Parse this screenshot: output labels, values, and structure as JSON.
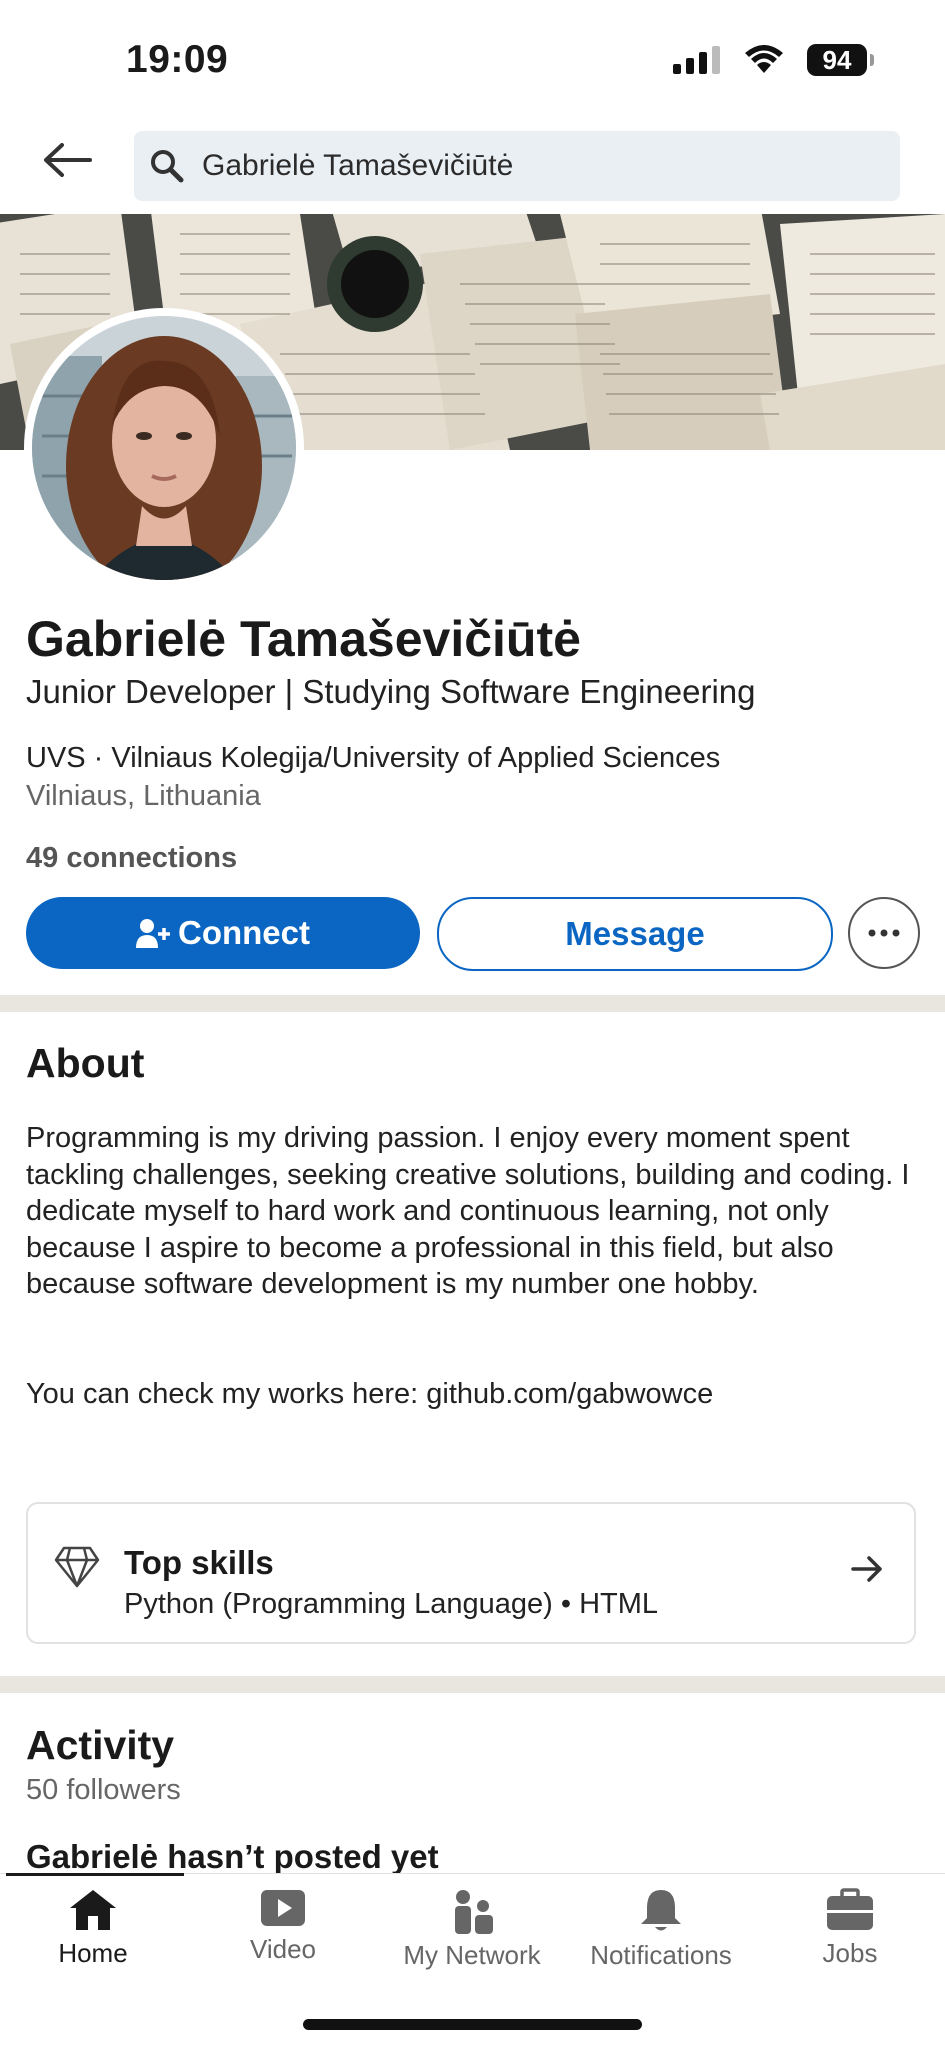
{
  "status_bar": {
    "time": "19:09",
    "battery": "94"
  },
  "search": {
    "query": "Gabrielė Tamaševičiūtė"
  },
  "profile": {
    "name": "Gabrielė Tamaševičiūtė",
    "headline": "Junior Developer | Studying Software Engineering",
    "education": "UVS · Vilniaus Kolegija/University of Applied Sciences",
    "location": "Vilniaus, Lithuania",
    "connections": "49 connections"
  },
  "actions": {
    "connect_label": "Connect",
    "message_label": "Message"
  },
  "about": {
    "title": "About",
    "text": "Programming is my driving passion. I enjoy every moment spent tackling challenges, seeking creative solutions, building and coding. I dedicate myself to hard work and continuous learning, not only because I aspire to become a professional in this field, but also because software development is my number one hobby.\n\n\nYou can check my works here: github.com/gabwowce"
  },
  "skills": {
    "title": "Top skills",
    "text": "Python (Programming Language) • HTML"
  },
  "activity": {
    "title": "Activity",
    "followers": "50 followers",
    "empty_text": "Gabrielė hasn’t posted yet"
  },
  "nav": {
    "items": [
      {
        "label": "Home",
        "icon": "home-icon",
        "active": true
      },
      {
        "label": "Video",
        "icon": "video-icon",
        "active": false
      },
      {
        "label": "My Network",
        "icon": "my-network-icon",
        "active": false
      },
      {
        "label": "Notifications",
        "icon": "bell-icon",
        "active": false
      },
      {
        "label": "Jobs",
        "icon": "briefcase-icon",
        "active": false
      }
    ]
  },
  "colors": {
    "brand": "#0a66c2",
    "divider": "#e9e5df",
    "search_bg": "#eaeff3"
  }
}
